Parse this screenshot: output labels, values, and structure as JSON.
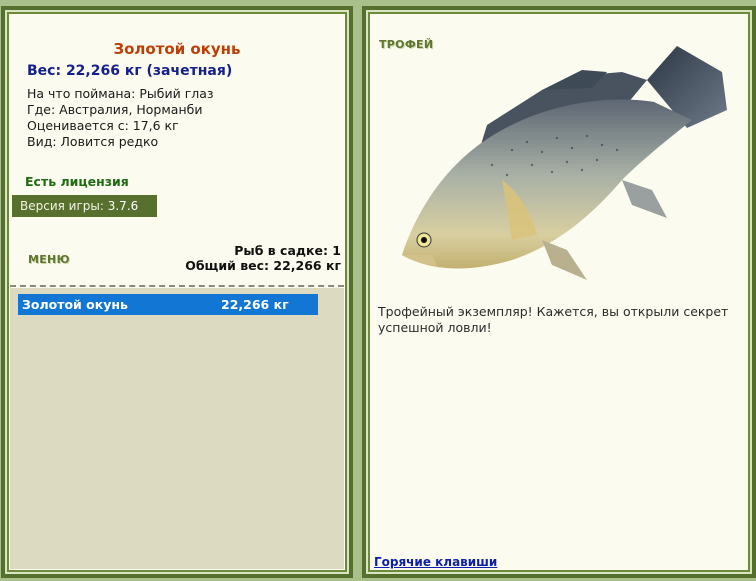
{
  "fish": {
    "name": "Золотой окунь",
    "weight_line": "Вес: 22,266 кг (зачетная)",
    "bait_line": "На что поймана: Рыбий глаз",
    "where_line": "Где: Австралия, Норманби",
    "value_line": "Оценивается с: 17,6 кг",
    "kind_line": "Вид: Ловится редко"
  },
  "license": "Есть лицензия",
  "version": {
    "label": "Версия игры:",
    "value": "3.7.6"
  },
  "menu_label": "МЕНЮ",
  "keepnet": {
    "count_line": "Рыб в садке: 1",
    "total_line": "Общий вес: 22,266 кг",
    "rows": [
      {
        "name": "Золотой окунь",
        "weight": "22,266 кг"
      }
    ]
  },
  "trophy": {
    "title": "ТРОФЕЙ",
    "description": "Трофейный экземпляр! Кажется, вы открыли секрет успешной ловли!"
  },
  "hotkeys_link": "Горячие клавиши",
  "colors": {
    "frame": "#55702e",
    "fish_name": "#bd3f06",
    "weight": "#16208a",
    "selection": "#1277d4",
    "link": "#0b1fa8"
  }
}
